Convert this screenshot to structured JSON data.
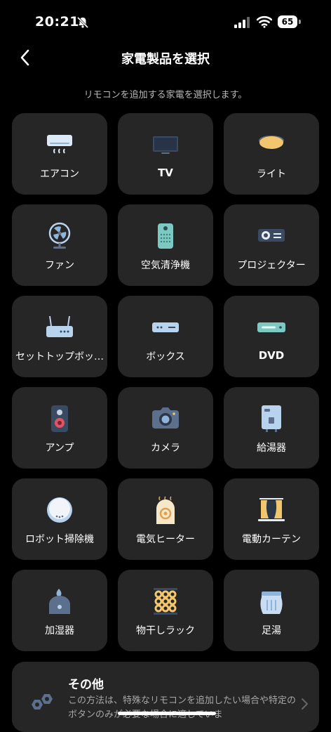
{
  "status_bar": {
    "time": "20:21",
    "battery": "65"
  },
  "header": {
    "title": "家電製品を選択",
    "subtitle": "リモコンを追加する家電を選択します。"
  },
  "devices": [
    {
      "label": "エアコン",
      "icon": "air-conditioner-icon"
    },
    {
      "label": "TV",
      "icon": "tv-icon"
    },
    {
      "label": "ライト",
      "icon": "ceiling-light-icon"
    },
    {
      "label": "ファン",
      "icon": "fan-icon"
    },
    {
      "label": "空気清浄機",
      "icon": "air-purifier-icon"
    },
    {
      "label": "プロジェクター",
      "icon": "projector-icon"
    },
    {
      "label": "セットトップボッ…",
      "icon": "router-icon"
    },
    {
      "label": "ボックス",
      "icon": "tv-box-icon"
    },
    {
      "label": "DVD",
      "icon": "dvd-player-icon"
    },
    {
      "label": "アンプ",
      "icon": "speaker-icon"
    },
    {
      "label": "カメラ",
      "icon": "camera-icon"
    },
    {
      "label": "給湯器",
      "icon": "water-heater-icon"
    },
    {
      "label": "ロボット掃除機",
      "icon": "robot-vacuum-icon"
    },
    {
      "label": "電気ヒーター",
      "icon": "heater-icon"
    },
    {
      "label": "電動カーテン",
      "icon": "curtain-icon"
    },
    {
      "label": "加湿器",
      "icon": "humidifier-icon"
    },
    {
      "label": "物干しラック",
      "icon": "drying-rack-icon"
    },
    {
      "label": "足湯",
      "icon": "foot-spa-icon"
    }
  ],
  "other": {
    "title": "その他",
    "description": "この方法は、特殊なリモコンを追加したい場合や特定のボタンのみが必要な場合に適していま"
  }
}
